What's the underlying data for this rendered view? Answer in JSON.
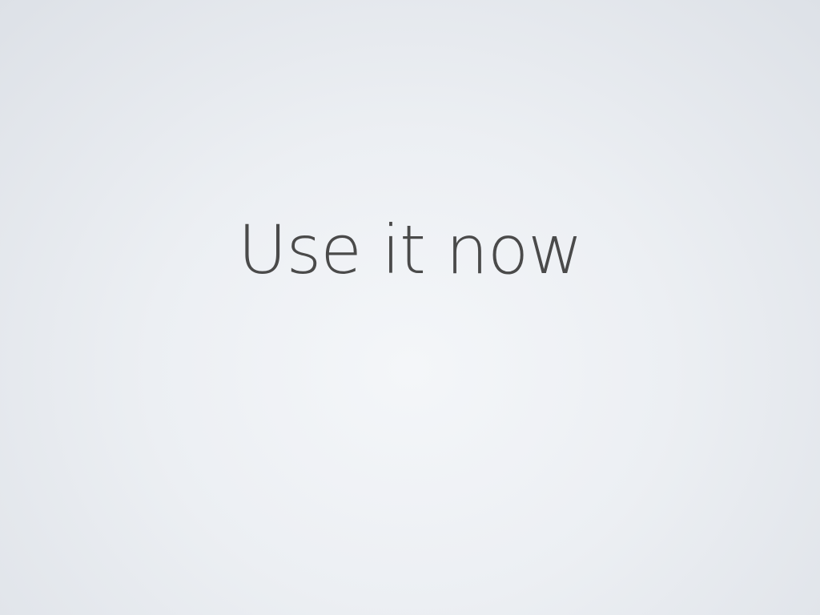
{
  "slide": {
    "title": "Use it now",
    "text_color": "#4a4a4a",
    "background_color": "#eceff3"
  }
}
